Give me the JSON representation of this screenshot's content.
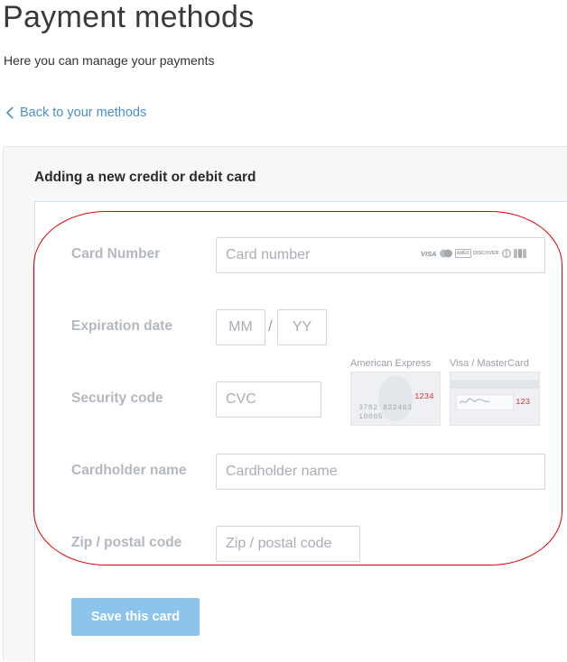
{
  "header": {
    "title": "Payment methods",
    "subtitle": "Here you can manage your payments",
    "back_link": "Back to your methods"
  },
  "form": {
    "heading": "Adding a new credit or debit card",
    "card_number": {
      "label": "Card Number",
      "placeholder": "Card number"
    },
    "expiration": {
      "label": "Expiration date",
      "month_placeholder": "MM",
      "year_placeholder": "YY",
      "separator": "/"
    },
    "security": {
      "label": "Security code",
      "placeholder": "CVC"
    },
    "cardholder": {
      "label": "Cardholder name",
      "placeholder": "Cardholder name"
    },
    "zip": {
      "label": "Zip / postal code",
      "placeholder": "Zip / postal code"
    },
    "card_brands": [
      "VISA",
      "MasterCard",
      "AMEX",
      "DISCOVER",
      "Diners",
      "JCB"
    ],
    "cvc_help": {
      "amex": {
        "caption": "American Express",
        "code": "1234",
        "number": "3782  822463  10005"
      },
      "visa": {
        "caption": "Visa / MasterCard",
        "code": "123"
      }
    },
    "save_label": "Save this card"
  },
  "colors": {
    "accent": "#4a90c8",
    "button": "#8dc4eb",
    "highlight": "#e00000"
  }
}
